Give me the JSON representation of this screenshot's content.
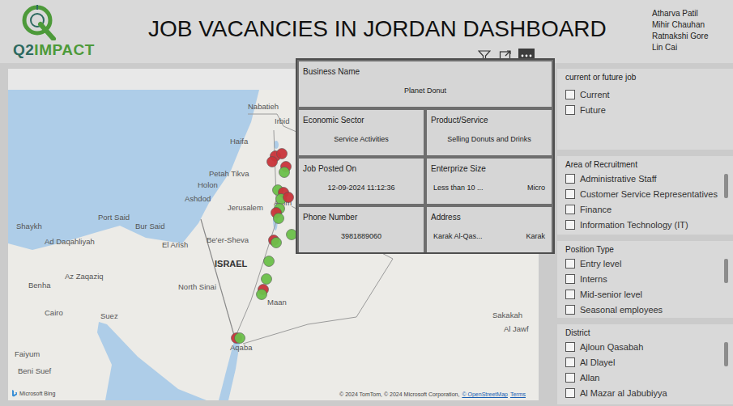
{
  "header": {
    "logo": {
      "q2": "Q2",
      "impact": "IMPACT"
    },
    "title": "JOB VACANCIES IN JORDAN DASHBOARD",
    "team": [
      "Atharva Patil",
      "Mihir Chauhan",
      "Ratnakshi Gore",
      "Lin Cai"
    ]
  },
  "map": {
    "labels": [
      "Nabatieh",
      "Irbid",
      "Haifa",
      "Petah Tikva",
      "Holon",
      "Ashdod",
      "Amm",
      "Jerusalem",
      "Port Said",
      "Shaykh",
      "Bur Said",
      "Ad Daqahliyah",
      "El Arish",
      "Be'er-Sheva",
      "ISRAEL",
      "Az Zaqaziq",
      "Benha",
      "North Sinai",
      "Cairo",
      "Suez",
      "Maan",
      "Sakakah",
      "Al Jawf",
      "Aqaba",
      "Faiyum",
      "Beni Suef"
    ],
    "pins": [
      {
        "color": "#c9343a"
      },
      {
        "color": "#c9343a"
      },
      {
        "color": "#c9343a"
      },
      {
        "color": "#c9343a"
      },
      {
        "color": "#6cc04a"
      },
      {
        "color": "#6cc04a"
      },
      {
        "color": "#c9343a"
      },
      {
        "color": "#6cc04a"
      },
      {
        "color": "#c9343a"
      },
      {
        "color": "#6cc04a"
      },
      {
        "color": "#c9343a"
      },
      {
        "color": "#6cc04a"
      },
      {
        "color": "#6cc04a"
      },
      {
        "color": "#c9343a"
      },
      {
        "color": "#6cc04a"
      },
      {
        "color": "#6cc04a"
      },
      {
        "color": "#6cc04a"
      },
      {
        "color": "#c9343a"
      },
      {
        "color": "#6cc04a"
      },
      {
        "color": "#c9343a"
      },
      {
        "color": "#6cc04a"
      }
    ],
    "provider": "Microsoft Bing",
    "attribution": {
      "text": "© 2024 TomTom, © 2024 Microsoft Corporation,",
      "links": [
        "© OpenStreetMap",
        "Terms"
      ]
    }
  },
  "cards": [
    {
      "label": "Business Name",
      "values": [
        "Planet Donut"
      ]
    },
    {
      "label": "Economic Sector",
      "values": [
        "Service Activities"
      ]
    },
    {
      "label": "Product/Service",
      "values": [
        "Selling Donuts and Drinks"
      ]
    },
    {
      "label": "Job Posted On",
      "values": [
        "12-09-2024 11:12:36"
      ]
    },
    {
      "label": "Enterprize Size",
      "values": [
        "Less than 10 ...",
        "Micro"
      ]
    },
    {
      "label": "Phone Number",
      "values": [
        "3981889060"
      ]
    },
    {
      "label": "Address",
      "values": [
        "Karak Al-Qas...",
        "Karak"
      ]
    }
  ],
  "slicers": [
    {
      "title": "current or future job",
      "items": [
        {
          "label": "Current",
          "checked": false
        },
        {
          "label": "Future",
          "checked": false
        }
      ]
    },
    {
      "title": "Area of Recruitment",
      "items": [
        {
          "label": "Administrative Staff",
          "checked": false
        },
        {
          "label": "Customer Service Representatives",
          "checked": false
        },
        {
          "label": "Finance",
          "checked": false
        },
        {
          "label": "Information Technology (IT)",
          "checked": false
        }
      ]
    },
    {
      "title": "Position Type",
      "items": [
        {
          "label": "Entry level",
          "checked": false
        },
        {
          "label": "Interns",
          "checked": false
        },
        {
          "label": "Mid-senior level",
          "checked": false
        },
        {
          "label": "Seasonal employees",
          "checked": false
        }
      ]
    },
    {
      "title": "District",
      "items": [
        {
          "label": "Ajloun Qasabah",
          "checked": false
        },
        {
          "label": "Al Dlayel",
          "checked": false
        },
        {
          "label": "Allan",
          "checked": false
        },
        {
          "label": "Al Mazar al Jabubiyya",
          "checked": false
        }
      ]
    }
  ]
}
